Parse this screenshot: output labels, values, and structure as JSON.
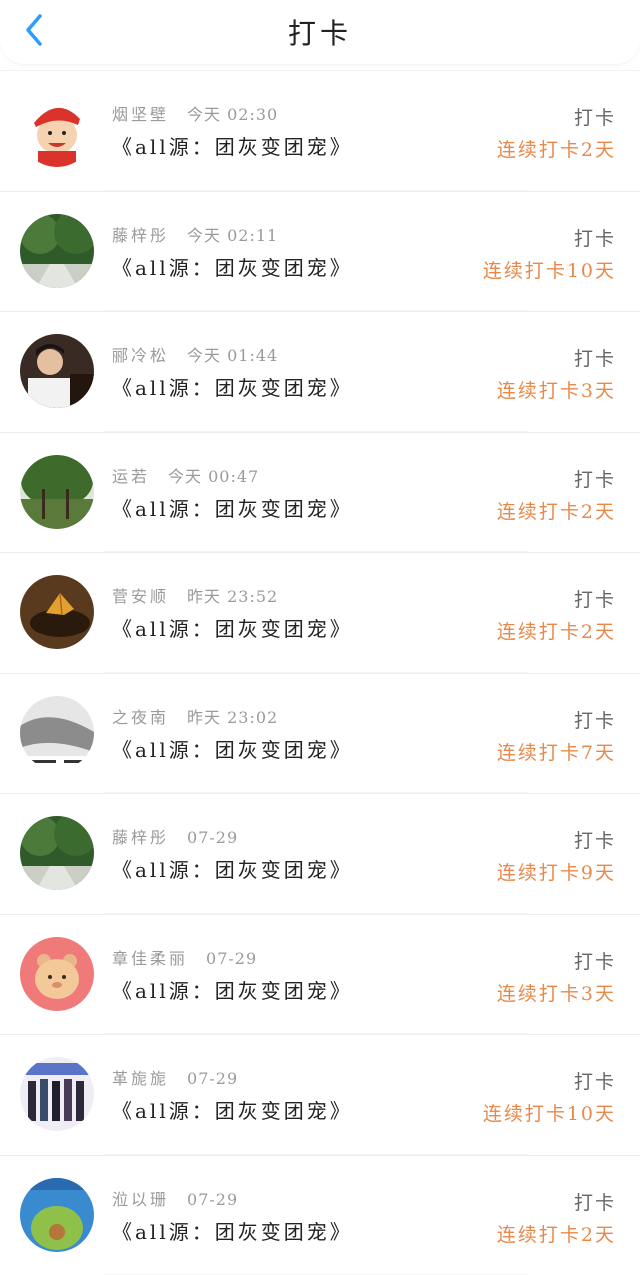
{
  "header": {
    "title": "打卡"
  },
  "colors": {
    "accent_blue": "#2d9cff",
    "streak_orange": "#e8894a"
  },
  "icons": {
    "back": "chevron-left-icon"
  },
  "entries": [
    {
      "name": "烟坚壁",
      "time": "今天 02:30",
      "content": "《all源：团灰变团宠》",
      "type": "打卡",
      "streak": "连续打卡2天"
    },
    {
      "name": "藤梓彤",
      "time": "今天 02:11",
      "content": "《all源：团灰变团宠》",
      "type": "打卡",
      "streak": "连续打卡10天"
    },
    {
      "name": "郦冷松",
      "time": "今天 01:44",
      "content": "《all源：团灰变团宠》",
      "type": "打卡",
      "streak": "连续打卡3天"
    },
    {
      "name": "运若",
      "time": "今天 00:47",
      "content": "《all源：团灰变团宠》",
      "type": "打卡",
      "streak": "连续打卡2天"
    },
    {
      "name": "菅安顺",
      "time": "昨天 23:52",
      "content": "《all源：团灰变团宠》",
      "type": "打卡",
      "streak": "连续打卡2天"
    },
    {
      "name": "之夜南",
      "time": "昨天 23:02",
      "content": "《all源：团灰变团宠》",
      "type": "打卡",
      "streak": "连续打卡7天"
    },
    {
      "name": "藤梓彤",
      "time": "07-29",
      "content": "《all源：团灰变团宠》",
      "type": "打卡",
      "streak": "连续打卡9天"
    },
    {
      "name": "章佳柔丽",
      "time": "07-29",
      "content": "《all源：团灰变团宠》",
      "type": "打卡",
      "streak": "连续打卡3天"
    },
    {
      "name": "革旎旎",
      "time": "07-29",
      "content": "《all源：团灰变团宠》",
      "type": "打卡",
      "streak": "连续打卡10天"
    },
    {
      "name": "涖以珊",
      "time": "07-29",
      "content": "《all源：团灰变团宠》",
      "type": "打卡",
      "streak": "连续打卡2天"
    }
  ]
}
